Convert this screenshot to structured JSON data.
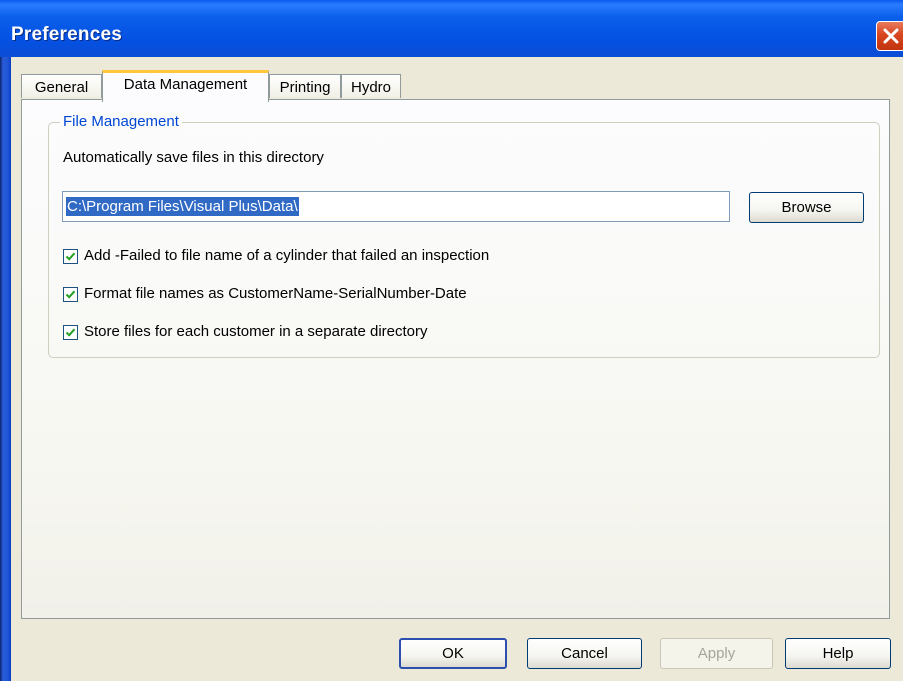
{
  "window": {
    "title": "Preferences"
  },
  "tabs": [
    {
      "label": "General"
    },
    {
      "label": "Data Management"
    },
    {
      "label": "Printing"
    },
    {
      "label": "Hydro"
    }
  ],
  "active_tab": "Data Management",
  "file_management": {
    "group_title": "File Management",
    "directory_label": "Automatically save files in this directory",
    "directory_value": "C:\\Program Files\\Visual Plus\\Data\\",
    "browse_label": "Browse",
    "options": [
      {
        "label": "Add -Failed to file name of a cylinder that failed an inspection",
        "checked": true
      },
      {
        "label": "Format file names as CustomerName-SerialNumber-Date",
        "checked": true
      },
      {
        "label": "Store files for each customer in a separate directory",
        "checked": true
      }
    ]
  },
  "buttons": {
    "ok": "OK",
    "cancel": "Cancel",
    "apply": "Apply",
    "help": "Help"
  },
  "icons": {
    "close": "close-icon",
    "check": "checkmark-icon"
  },
  "colors": {
    "titlebar": "#0551e3",
    "close_button": "#d8461f",
    "group_title": "#0046d5",
    "selection": "#316ac5",
    "checkmark": "#21a121",
    "active_tab_highlight": "#ffc83c"
  }
}
